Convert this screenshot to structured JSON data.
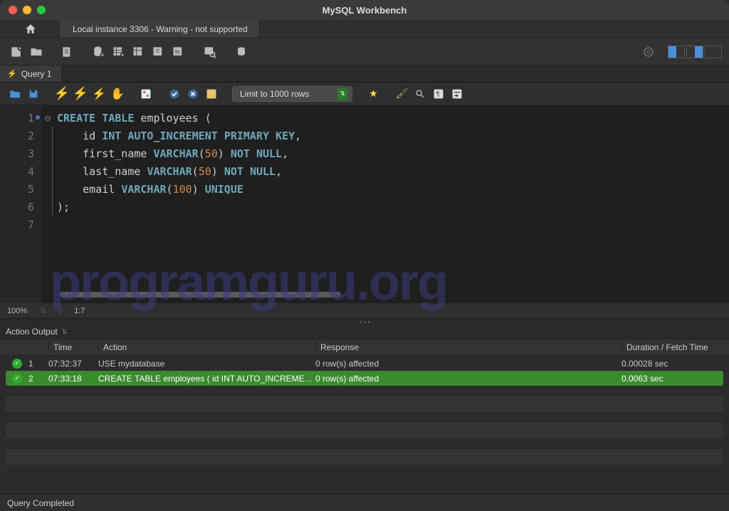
{
  "window": {
    "title": "MySQL Workbench"
  },
  "connection_tab": "Local instance 3306 - Warning - not supported",
  "query_tab": "Query 1",
  "limit_label": "Limit to 1000 rows",
  "zoom": "100%",
  "cursor_pos": "1:7",
  "code": {
    "lines": [
      {
        "n": "1",
        "indent": "",
        "tokens": [
          {
            "t": "CREATE",
            "c": "kw"
          },
          {
            "t": " ",
            "c": ""
          },
          {
            "t": "TABLE",
            "c": "kw"
          },
          {
            "t": " ",
            "c": ""
          },
          {
            "t": "employees",
            "c": "ident"
          },
          {
            "t": " (",
            "c": "paren"
          }
        ]
      },
      {
        "n": "2",
        "indent": "    ",
        "tokens": [
          {
            "t": "id",
            "c": "ident"
          },
          {
            "t": " ",
            "c": ""
          },
          {
            "t": "INT",
            "c": "type"
          },
          {
            "t": " ",
            "c": ""
          },
          {
            "t": "AUTO_INCREMENT",
            "c": "type"
          },
          {
            "t": " ",
            "c": ""
          },
          {
            "t": "PRIMARY",
            "c": "type"
          },
          {
            "t": " ",
            "c": ""
          },
          {
            "t": "KEY",
            "c": "type"
          },
          {
            "t": ",",
            "c": "paren"
          }
        ]
      },
      {
        "n": "3",
        "indent": "    ",
        "tokens": [
          {
            "t": "first_name",
            "c": "ident"
          },
          {
            "t": " ",
            "c": ""
          },
          {
            "t": "VARCHAR",
            "c": "type"
          },
          {
            "t": "(",
            "c": "paren"
          },
          {
            "t": "50",
            "c": "num"
          },
          {
            "t": ")",
            "c": "paren"
          },
          {
            "t": " ",
            "c": ""
          },
          {
            "t": "NOT",
            "c": "type"
          },
          {
            "t": " ",
            "c": ""
          },
          {
            "t": "NULL",
            "c": "type"
          },
          {
            "t": ",",
            "c": "paren"
          }
        ]
      },
      {
        "n": "4",
        "indent": "    ",
        "tokens": [
          {
            "t": "last_name",
            "c": "ident"
          },
          {
            "t": " ",
            "c": ""
          },
          {
            "t": "VARCHAR",
            "c": "type"
          },
          {
            "t": "(",
            "c": "paren"
          },
          {
            "t": "50",
            "c": "num"
          },
          {
            "t": ")",
            "c": "paren"
          },
          {
            "t": " ",
            "c": ""
          },
          {
            "t": "NOT",
            "c": "type"
          },
          {
            "t": " ",
            "c": ""
          },
          {
            "t": "NULL",
            "c": "type"
          },
          {
            "t": ",",
            "c": "paren"
          }
        ]
      },
      {
        "n": "5",
        "indent": "    ",
        "tokens": [
          {
            "t": "email",
            "c": "ident"
          },
          {
            "t": " ",
            "c": ""
          },
          {
            "t": "VARCHAR",
            "c": "type"
          },
          {
            "t": "(",
            "c": "paren"
          },
          {
            "t": "100",
            "c": "num"
          },
          {
            "t": ")",
            "c": "paren"
          },
          {
            "t": " ",
            "c": ""
          },
          {
            "t": "UNIQUE",
            "c": "type"
          }
        ]
      },
      {
        "n": "6",
        "indent": "",
        "tokens": [
          {
            "t": ");",
            "c": "paren"
          }
        ]
      },
      {
        "n": "7",
        "indent": "",
        "tokens": []
      }
    ]
  },
  "output": {
    "panel_label": "Action Output",
    "headers": {
      "time": "Time",
      "action": "Action",
      "response": "Response",
      "duration": "Duration / Fetch Time"
    },
    "rows": [
      {
        "num": "1",
        "time": "07:32:37",
        "action": "USE mydatabase",
        "response": "0 row(s) affected",
        "duration": "0.00028 sec",
        "hl": false
      },
      {
        "num": "2",
        "time": "07:33:18",
        "action": "CREATE TABLE employees (     id INT AUTO_INCREMEN...",
        "response": "0 row(s) affected",
        "duration": "0.0063 sec",
        "hl": true
      }
    ]
  },
  "status": "Query Completed",
  "watermark": "programguru.org"
}
